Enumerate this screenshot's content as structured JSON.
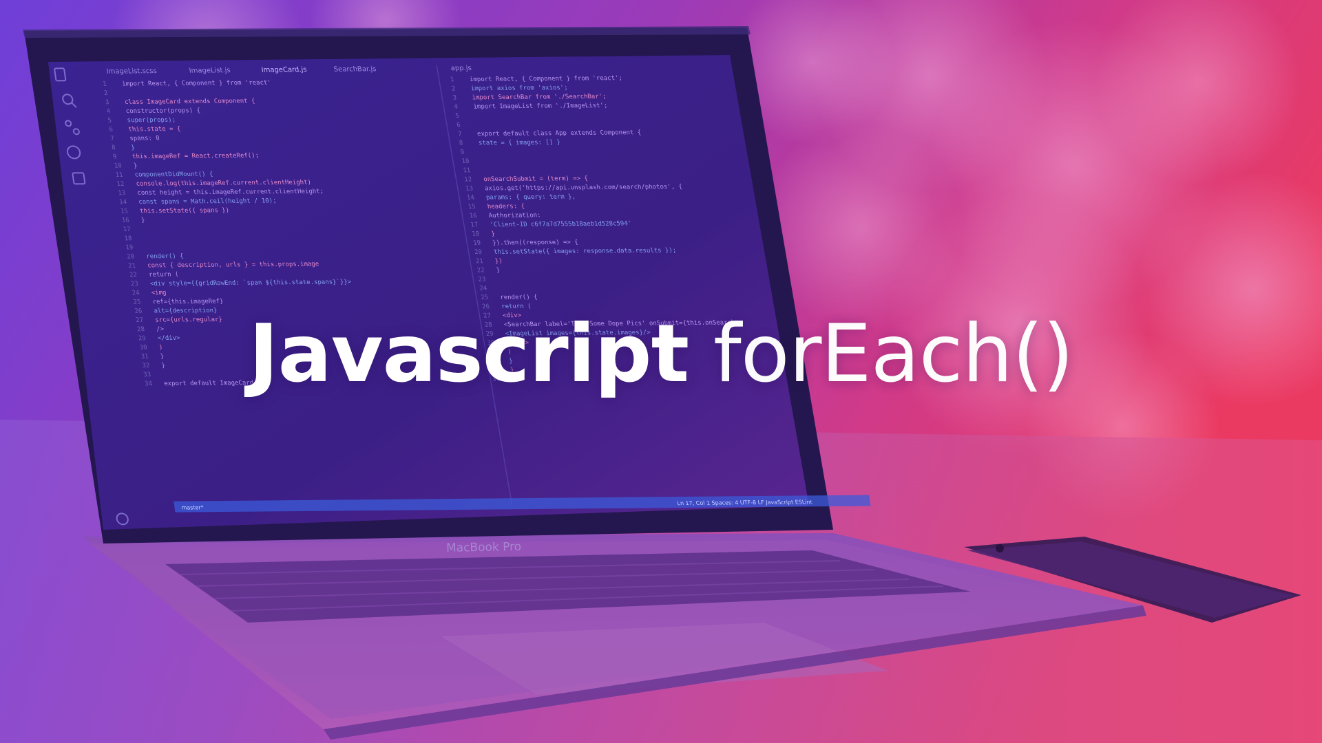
{
  "headline": {
    "bold": "Javascript",
    "light": "forEach()"
  },
  "laptop_brand": "MacBook Pro",
  "editor": {
    "tabs": [
      "ImageList.scss",
      "ImageList.js",
      "ImageCard.js",
      "SearchBar.js",
      "app.js"
    ],
    "left_code": [
      "import React, { Component } from 'react'",
      "",
      "class ImageCard extends Component {",
      "  constructor(props) {",
      "    super(props);",
      "    this.state = {",
      "      spans: 0",
      "    }",
      "    this.imageRef = React.createRef();",
      "  }",
      "  componentDidMount() {",
      "    console.log(this.imageRef.current.clientHeight)",
      "    const height = this.imageRef.current.clientHeight;",
      "    const spans = Math.ceil(height / 10);",
      "    this.setState({ spans })",
      "  }",
      "",
      "",
      "",
      "  render() {",
      "    const { description, urls } = this.props.image",
      "    return (",
      "      <div style={{gridRowEnd: `span ${this.state.spans}`}}>",
      "        <img",
      "          ref={this.imageRef}",
      "          alt={description}",
      "          src={urls.regular}",
      "        />",
      "      </div>",
      "    )",
      "  }",
      "}",
      "",
      "export default ImageCard"
    ],
    "right_code": [
      "import React, { Component } from 'react';",
      "import axios from 'axios';",
      "import SearchBar from './SearchBar';",
      "import ImageList from './ImageList';",
      "",
      "",
      "export default class App extends Component {",
      "  state = { images: [] }",
      "",
      "",
      "",
      "  onSearchSubmit = (term) => {",
      "    axios.get('https://api.unsplash.com/search/photos', {",
      "      params: { query: term },",
      "      headers: {",
      "        Authorization:",
      "          'Client-ID c6f7a7d7555b18aeb1d528c594'",
      "      }",
      "    }).then((response) => {",
      "      this.setState({ images: response.data.results });",
      "    })",
      "  }",
      "",
      "",
      "  render() {",
      "    return (",
      "      <div>",
      "        <SearchBar label='Type Some Dope Pics' onSubmit={this.onSearch",
      "        <ImageList images={this.state.images}/>",
      "      </div>",
      "    )",
      "  }",
      "}",
      ""
    ],
    "status_bar_left": "master*",
    "status_bar_right": "Ln 17, Col 1   Spaces: 4   UTF-8   LF   JavaScript   ESLint"
  },
  "colors": {
    "gradient_left": "#7a3fd6",
    "gradient_mid": "#b23aa8",
    "gradient_right": "#e8345e",
    "screen": "#2a1a6a",
    "code_purple": "#c9a6ff",
    "code_blue": "#8fb4ff",
    "code_pink": "#ff9ad6",
    "status_bar": "#3b5bd9"
  }
}
